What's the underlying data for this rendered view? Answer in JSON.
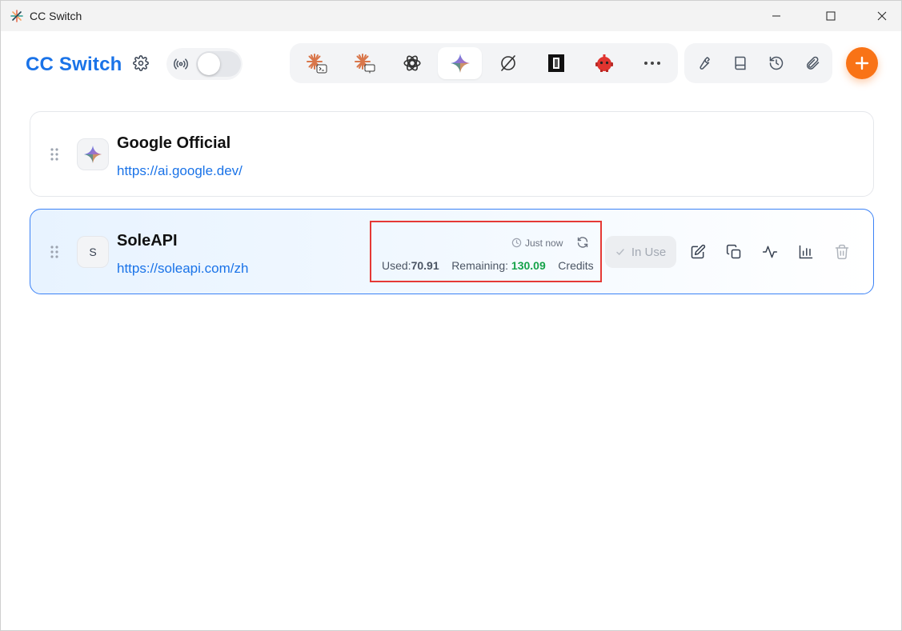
{
  "window": {
    "title": "CC Switch"
  },
  "header": {
    "brand": "CC Switch",
    "proxy_toggle": {
      "on": false
    }
  },
  "app_tabs": [
    {
      "name": "claude-code",
      "icon": "claude-terminal-icon",
      "active": false
    },
    {
      "name": "claude-desktop",
      "icon": "claude-desktop-icon",
      "active": false
    },
    {
      "name": "openai",
      "icon": "openai-icon",
      "active": false
    },
    {
      "name": "gemini",
      "icon": "gemini-icon",
      "active": true
    },
    {
      "name": "opencode",
      "icon": "opencode-icon",
      "active": false
    },
    {
      "name": "cursor-like",
      "icon": "black-square-icon",
      "active": false
    },
    {
      "name": "droid",
      "icon": "red-robot-icon",
      "active": false
    },
    {
      "name": "more",
      "icon": "more-icon",
      "active": false
    }
  ],
  "toolbar": [
    "wrench-icon",
    "book-icon",
    "history-icon",
    "paperclip-icon"
  ],
  "providers": [
    {
      "name": "Google Official",
      "url": "https://ai.google.dev/",
      "avatar": "gemini-icon"
    },
    {
      "name": "SoleAPI",
      "url": "https://soleapi.com/zh",
      "avatar_letter": "S",
      "usage": {
        "time": "Just now",
        "used_label": "Used:",
        "used_value": "70.91",
        "remaining_label": "Remaining:",
        "remaining_value": "130.09",
        "unit": "Credits"
      },
      "in_use_label": "In Use"
    }
  ],
  "colors": {
    "brand": "#1a73e8",
    "accent": "#f97316",
    "remaining": "#16a34a",
    "highlight_box": "#e53935",
    "active_border": "#3b82f6"
  }
}
